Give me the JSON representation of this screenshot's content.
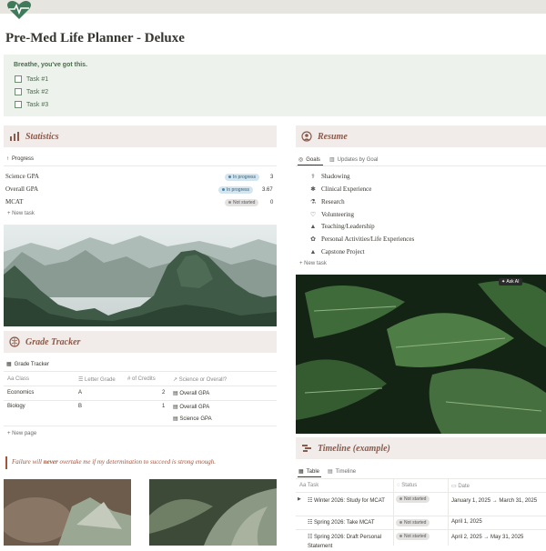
{
  "page": {
    "title": "Pre-Med Life Planner - Deluxe"
  },
  "callout": {
    "title": "Breathe, you've got this.",
    "tasks": [
      "Task #1",
      "Task #2",
      "Task #3"
    ]
  },
  "statistics": {
    "title": "Statistics",
    "view_label": "Progress",
    "rows": [
      {
        "name": "Science GPA",
        "status": "In progress",
        "value": "3"
      },
      {
        "name": "Overall GPA",
        "status": "In progress",
        "value": "3.67"
      },
      {
        "name": "MCAT",
        "status": "Not started",
        "value": "0"
      }
    ],
    "new_task": "New task"
  },
  "resume": {
    "title": "Resume",
    "tabs": [
      "Goals",
      "Updates by Goal"
    ],
    "goals": [
      {
        "label": "Shadowing",
        "icon": "stethoscope-icon"
      },
      {
        "label": "Clinical Experience",
        "icon": "star-of-life-icon"
      },
      {
        "label": "Research",
        "icon": "flask-icon"
      },
      {
        "label": "Volunteering",
        "icon": "heart-hands-icon"
      },
      {
        "label": "Teaching/Leadership",
        "icon": "graduation-cap-icon"
      },
      {
        "label": "Personal Activities/Life Experiences",
        "icon": "flower-icon"
      },
      {
        "label": "Capstone Project",
        "icon": "graduation-cap-icon"
      }
    ],
    "new_task": "New task",
    "ask_ai": "Ask AI"
  },
  "grade_tracker": {
    "title": "Grade Tracker",
    "view_label": "Grade Tracker",
    "columns": [
      "Class",
      "Letter Grade",
      "of Credits",
      "Science or Overall?"
    ],
    "rows": [
      {
        "class": "Economics",
        "grade": "A",
        "credits": "2",
        "type": [
          "Overall GPA"
        ]
      },
      {
        "class": "Biology",
        "grade": "B",
        "credits": "1",
        "type": [
          "Overall GPA",
          "Science GPA"
        ]
      }
    ],
    "new_page": "New page"
  },
  "quote": {
    "before": "Failure will ",
    "emphasis": "never",
    "after": " overtake me if my determination to succeed is strong enough."
  },
  "timeline": {
    "title": "Timeline (example)",
    "tabs": [
      "Table",
      "Timeline"
    ],
    "columns": [
      "Task",
      "Status",
      "Date"
    ],
    "rows": [
      {
        "task": "Winter 2026: Study for MCAT",
        "status": "Not started",
        "date": "January 1, 2025 → March 31, 2025"
      },
      {
        "task": "Spring 2026: Take MCAT",
        "status": "Not started",
        "date": "April 1, 2025"
      },
      {
        "task": "Spring 2026: Draft Personal Statement",
        "status": "Not started",
        "date": "April 2, 2025 → May 31, 2025"
      }
    ]
  },
  "colors": {
    "accent": "#8a5a4a",
    "callout_bg": "#edf3ec",
    "section_bg": "#f1ecea",
    "quote": "#a3543b",
    "logo": "#3f7a5a"
  }
}
